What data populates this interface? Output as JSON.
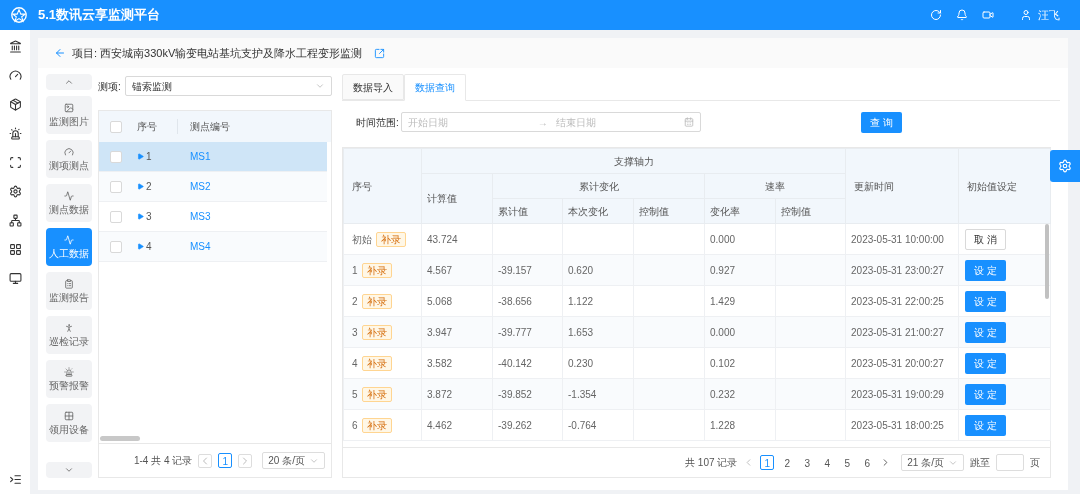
{
  "app": {
    "title": "5.1数讯云享监测平台",
    "user_name": "汪飞"
  },
  "project_title": "项目: 西安城南330kV输变电站基坑支护及降水工程变形监测",
  "side_nav": [
    {
      "label": "监测图片",
      "selected": false
    },
    {
      "label": "测项测点",
      "selected": false
    },
    {
      "label": "测点数据",
      "selected": false
    },
    {
      "label": "人工数据",
      "selected": true
    },
    {
      "label": "监测报告",
      "selected": false
    },
    {
      "label": "巡检记录",
      "selected": false
    },
    {
      "label": "预警报警",
      "selected": false
    },
    {
      "label": "领用设备",
      "selected": false
    }
  ],
  "measure_select": {
    "label": "测项:",
    "value": "锚索监测"
  },
  "points_table": {
    "columns": [
      "序号",
      "测点编号"
    ],
    "all_checked": false,
    "rows": [
      {
        "index": "1",
        "code": "MS1",
        "checked": false,
        "selected": true
      },
      {
        "index": "2",
        "code": "MS2",
        "checked": false,
        "selected": false
      },
      {
        "index": "3",
        "code": "MS3",
        "checked": false,
        "selected": false
      },
      {
        "index": "4",
        "code": "MS4",
        "checked": false,
        "selected": false
      }
    ],
    "pagination": {
      "summary": "1-4 共 4 记录",
      "pages": [
        {
          "label": "1",
          "selected": true
        }
      ],
      "page_size": "20 条/页"
    }
  },
  "tabs": [
    {
      "label": "数据导入",
      "selected": false
    },
    {
      "label": "数据查询",
      "selected": true
    }
  ],
  "filter": {
    "label": "时间范围:",
    "start_placeholder": "开始日期",
    "separator": "→",
    "end_placeholder": "结束日期"
  },
  "query_button": "查 询",
  "data_table": {
    "headers": {
      "index": "序号",
      "group": "支撑轴力",
      "calc": "计算值",
      "cumulative_group": "累计变化",
      "rate_group": "速率",
      "sub": [
        "累计值",
        "本次变化",
        "控制值",
        "变化率",
        "控制值"
      ],
      "time": "更新时间",
      "action": "初始值设定"
    },
    "rows": [
      {
        "kind": "initial",
        "index": "初始",
        "tag": "补录",
        "calc": "43.724",
        "rate": "0.000",
        "time": "2023-05-31 10:00:00",
        "action": "取 消"
      },
      {
        "kind": "record",
        "index": "1",
        "tag": "补录",
        "calc": "4.567",
        "cumulative": "-39.157",
        "change": "0.620",
        "rate": "0.927",
        "time": "2023-05-31 23:00:27",
        "action": "设 定"
      },
      {
        "kind": "record",
        "index": "2",
        "tag": "补录",
        "calc": "5.068",
        "cumulative": "-38.656",
        "change": "1.122",
        "rate": "1.429",
        "time": "2023-05-31 22:00:25",
        "action": "设 定"
      },
      {
        "kind": "record",
        "index": "3",
        "tag": "补录",
        "calc": "3.947",
        "cumulative": "-39.777",
        "change": "1.653",
        "rate": "0.000",
        "time": "2023-05-31 21:00:27",
        "action": "设 定"
      },
      {
        "kind": "record",
        "index": "4",
        "tag": "补录",
        "calc": "3.582",
        "cumulative": "-40.142",
        "change": "0.230",
        "rate": "0.102",
        "time": "2023-05-31 20:00:27",
        "action": "设 定"
      },
      {
        "kind": "record",
        "index": "5",
        "tag": "补录",
        "calc": "3.872",
        "cumulative": "-39.852",
        "change": "-1.354",
        "rate": "0.232",
        "time": "2023-05-31 19:00:29",
        "action": "设 定"
      },
      {
        "kind": "record",
        "index": "6",
        "tag": "补录",
        "calc": "4.462",
        "cumulative": "-39.262",
        "change": "-0.764",
        "rate": "1.228",
        "time": "2023-05-31 18:00:25",
        "action": "设 定"
      }
    ],
    "pagination": {
      "summary": "共 107 记录",
      "pages": [
        {
          "label": "1",
          "selected": true
        },
        {
          "label": "2",
          "selected": false
        },
        {
          "label": "3",
          "selected": false
        },
        {
          "label": "4",
          "selected": false
        },
        {
          "label": "5",
          "selected": false
        },
        {
          "label": "6",
          "selected": false
        }
      ],
      "page_size": "21 条/页",
      "jump_label": "跳至",
      "jump_suffix": "页"
    }
  }
}
